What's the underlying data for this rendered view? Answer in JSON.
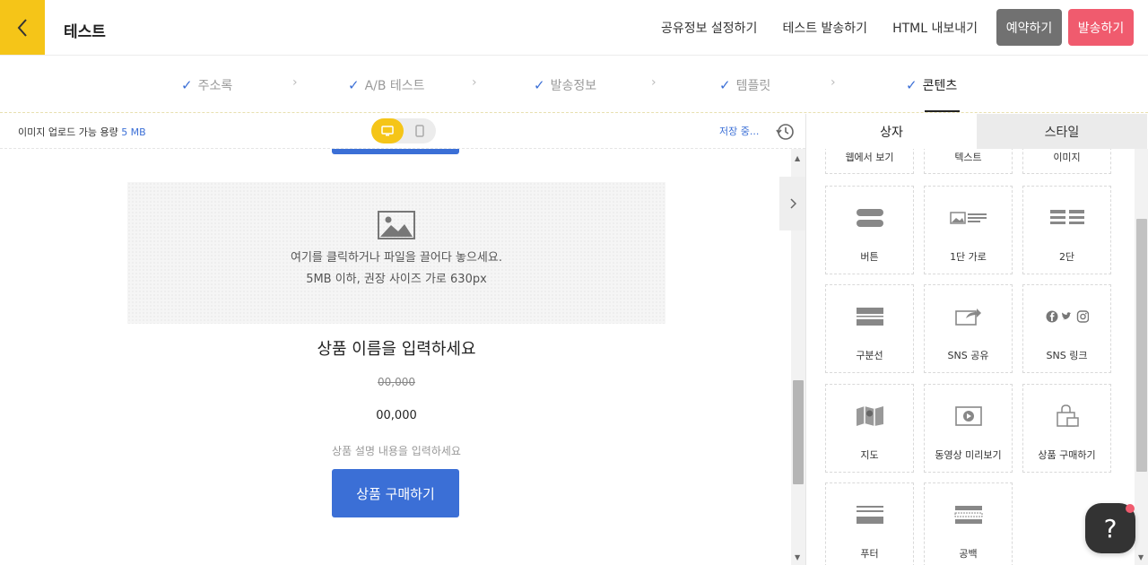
{
  "header": {
    "title": "테스트",
    "links": [
      "공유정보 설정하기",
      "테스트 발송하기",
      "HTML 내보내기"
    ],
    "reserve_label": "예약하기",
    "send_label": "발송하기"
  },
  "steps": [
    "주소록",
    "A/B 테스트",
    "발송정보",
    "템플릿",
    "콘텐츠"
  ],
  "toolbar": {
    "upload_prefix": "이미지 업로드 가능 용량 ",
    "upload_size": "5 MB",
    "saving": "저장 중..."
  },
  "editor": {
    "drop_text1": "여기를 클릭하거나 파일을 끌어다 놓으세요.",
    "drop_text2": "5MB 이하, 권장 사이즈 가로 630px",
    "product_name": "상품 이름을 입력하세요",
    "price_old": "00,000",
    "price_new": "00,000",
    "product_desc": "상품 설명 내용을 입력하세요",
    "buy_label": "상품 구매하기"
  },
  "panel": {
    "tabs": [
      "상자",
      "스타일"
    ],
    "blocks": [
      {
        "label": "웹에서 보기",
        "icon": "web-view-icon"
      },
      {
        "label": "텍스트",
        "icon": "text-icon"
      },
      {
        "label": "이미지",
        "icon": "image-icon"
      },
      {
        "label": "버튼",
        "icon": "button-icon"
      },
      {
        "label": "1단 가로",
        "icon": "one-column-icon"
      },
      {
        "label": "2단",
        "icon": "two-column-icon"
      },
      {
        "label": "구분선",
        "icon": "divider-icon"
      },
      {
        "label": "SNS 공유",
        "icon": "share-icon"
      },
      {
        "label": "SNS 링크",
        "icon": "sns-link-icon"
      },
      {
        "label": "지도",
        "icon": "map-icon"
      },
      {
        "label": "동영상 미리보기",
        "icon": "video-icon"
      },
      {
        "label": "상품 구매하기",
        "icon": "shopping-bag-icon"
      },
      {
        "label": "푸터",
        "icon": "footer-icon"
      },
      {
        "label": "공백",
        "icon": "spacer-icon"
      }
    ]
  },
  "help": {
    "label": "?"
  },
  "colors": {
    "accent_yellow": "#f5c518",
    "primary_blue": "#3b6fd6",
    "send_red": "#f05b6e",
    "reserve_gray": "#717171"
  }
}
